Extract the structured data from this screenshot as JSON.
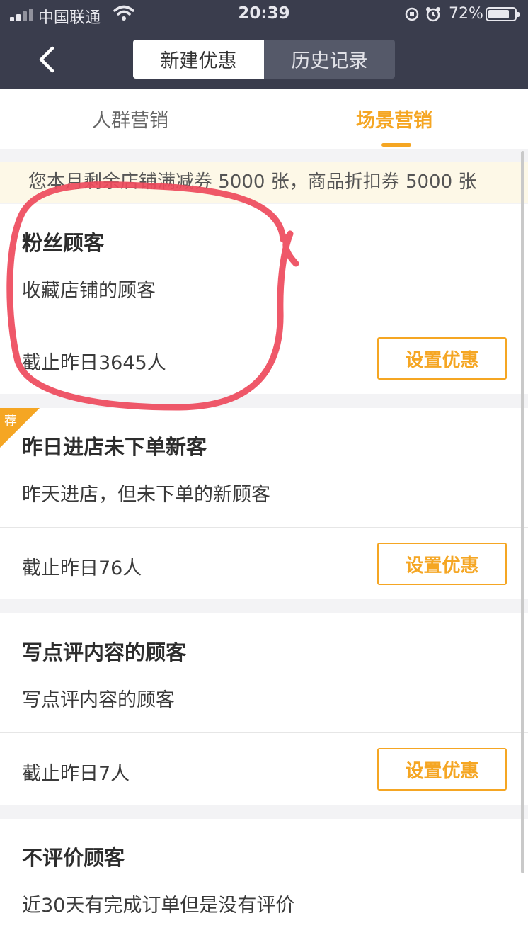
{
  "status_bar": {
    "carrier": "中国联通",
    "time": "20:39",
    "battery": "72%",
    "battery_level": 0.72
  },
  "header": {
    "segments": [
      {
        "label": "新建优惠",
        "selected": true
      },
      {
        "label": "历史记录",
        "selected": false
      }
    ]
  },
  "tabs": [
    {
      "label": "人群营销",
      "active": false
    },
    {
      "label": "场景营销",
      "active": true
    }
  ],
  "notice": "您本月剩余店铺满减券 5000 张，商品折扣券 5000 张",
  "cards": [
    {
      "title": "粉丝顾客",
      "desc": "收藏店铺的顾客",
      "count": "截止昨日3645人",
      "button": "设置优惠",
      "badge": ""
    },
    {
      "title": "昨日进店未下单新客",
      "desc": "昨天进店，但未下单的新顾客",
      "count": "截止昨日76人",
      "button": "设置优惠",
      "badge": "荐"
    },
    {
      "title": "写点评内容的顾客",
      "desc": "写点评内容的顾客",
      "count": "截止昨日7人",
      "button": "设置优惠",
      "badge": ""
    },
    {
      "title": "不评价顾客",
      "desc": "近30天有完成订单但是没有评价",
      "count": "",
      "button": "",
      "badge": ""
    }
  ],
  "colors": {
    "header_bg": "#3a3d4d",
    "accent": "#f5a623",
    "notice_bg": "#fdf8e7",
    "annotation": "#ee4a5c"
  },
  "icons": [
    "signal-icon",
    "wifi-icon",
    "orientation-lock-icon",
    "alarm-icon",
    "battery-icon",
    "back-arrow-icon"
  ]
}
